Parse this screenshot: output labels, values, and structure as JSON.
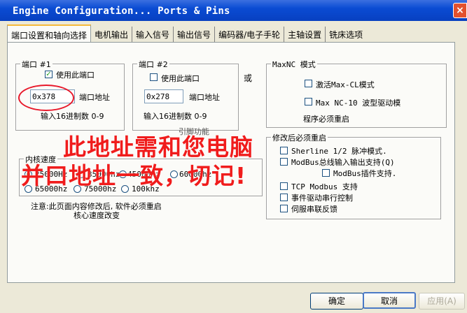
{
  "window": {
    "title": "Engine Configuration... Ports & Pins",
    "close_label": "×"
  },
  "tabs": [
    {
      "label": "端口设置和轴向选择",
      "active": true
    },
    {
      "label": "电机输出"
    },
    {
      "label": "输入信号"
    },
    {
      "label": "输出信号"
    },
    {
      "label": "编码器/电子手轮"
    },
    {
      "label": "主轴设置"
    },
    {
      "label": "铣床选项"
    }
  ],
  "port1": {
    "title": "端口 #1",
    "enable_label": "使用此端口",
    "enabled": true,
    "address_value": "0x378",
    "address_label": "端口地址",
    "hint": "输入16进制数 0-9"
  },
  "port2": {
    "title": "端口 #2",
    "enable_label": "使用此端口",
    "enabled": false,
    "address_value": "0x278",
    "address_label": "端口地址",
    "hint": "输入16进制数 0-9",
    "partial_text": "引脚功能"
  },
  "or_label": "或",
  "maxnc": {
    "title": "MaxNC 模式",
    "activate_label": "激活Max-CL模式",
    "nc10_label": "Max NC-10 波型驱动模",
    "restart_note": "程序必须重启"
  },
  "restart_group": {
    "title": "修改后必须重启",
    "items": [
      {
        "label": "Sherline 1/2 脉冲模式."
      },
      {
        "label": "ModBus总线输入输出支持(Q)"
      },
      {
        "label": "ModBus插件支持."
      },
      {
        "label": "TCP Modbus 支持"
      },
      {
        "label": "事件驱动串行控制"
      },
      {
        "label": "伺服串联反馈"
      }
    ]
  },
  "kernel": {
    "title": "内核速度",
    "options": [
      {
        "label": "25000Hz",
        "selected": true
      },
      {
        "label": "35000hz"
      },
      {
        "label": "45000hz"
      },
      {
        "label": "60000hz"
      },
      {
        "label": "65000hz"
      },
      {
        "label": "75000hz"
      },
      {
        "label": "100khz"
      }
    ],
    "note_line1": "注意:此页面内容修改后, 软件必须重启",
    "note_line2": "核心速度改变"
  },
  "annotation": {
    "line1": "此地址需和您电脑",
    "line2": "并口地址一致，切记!",
    "color": "#f01c1c"
  },
  "buttons": {
    "ok": "确定",
    "cancel": "取消",
    "apply": "应用(A)"
  }
}
